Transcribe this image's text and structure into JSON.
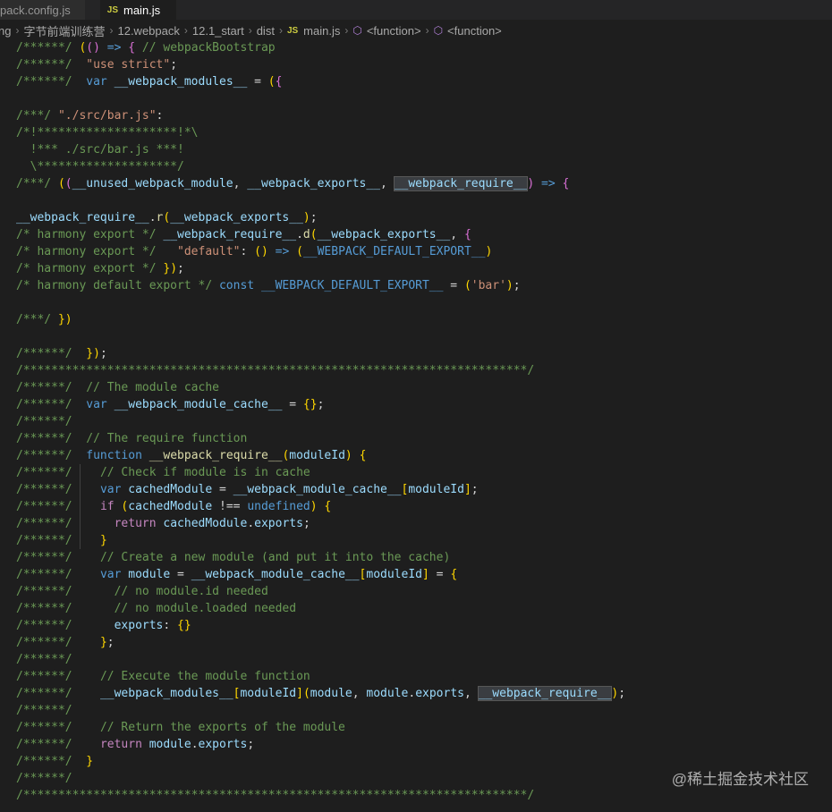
{
  "tabs": [
    {
      "label": "pack.config.js",
      "active": false
    },
    {
      "label": "main.js",
      "active": true,
      "badge": "JS"
    }
  ],
  "breadcrumb": {
    "items": [
      "ng",
      "字节前端训练营",
      "12.webpack",
      "12.1_start",
      "dist"
    ],
    "file": "main.js",
    "file_badge": "JS",
    "symbols": [
      "<function>",
      "<function>"
    ]
  },
  "code_lines": [
    "/******/ (() => { // webpackBootstrap",
    "/******/  \"use strict\";",
    "/******/  var __webpack_modules__ = ({",
    "",
    "/***/ \"./src/bar.js\":",
    "/*!********************!*\\",
    "  !*** ./src/bar.js ***!",
    "  \\********************/",
    "/***/ ((__unused_webpack_module, __webpack_exports__, __webpack_require__) => {",
    "",
    "__webpack_require__.r(__webpack_exports__);",
    "/* harmony export */ __webpack_require__.d(__webpack_exports__, {",
    "/* harmony export */   \"default\": () => (__WEBPACK_DEFAULT_EXPORT__)",
    "/* harmony export */ });",
    "/* harmony default export */ const __WEBPACK_DEFAULT_EXPORT__ = ('bar');",
    "",
    "/***/ })",
    "",
    "/******/  });",
    "/************************************************************************/",
    "/******/  // The module cache",
    "/******/  var __webpack_module_cache__ = {};",
    "/******/",
    "/******/  // The require function",
    "/******/  function __webpack_require__(moduleId) {",
    "/******/    // Check if module is in cache",
    "/******/    var cachedModule = __webpack_module_cache__[moduleId];",
    "/******/    if (cachedModule !== undefined) {",
    "/******/      return cachedModule.exports;",
    "/******/    }",
    "/******/    // Create a new module (and put it into the cache)",
    "/******/    var module = __webpack_module_cache__[moduleId] = {",
    "/******/      // no module.id needed",
    "/******/      // no module.loaded needed",
    "/******/      exports: {}",
    "/******/    };",
    "/******/",
    "/******/    // Execute the module function",
    "/******/    __webpack_modules__[moduleId](module, module.exports, __webpack_require__);",
    "/******/",
    "/******/    // Return the exports of the module",
    "/******/    return module.exports;",
    "/******/  }",
    "/******/",
    "/************************************************************************/"
  ],
  "watermark": "@稀土掘金技术社区",
  "colors": {
    "editor_bg": "#1e1e1e",
    "comment": "#6a9955",
    "keyword": "#569cd6",
    "control_keyword": "#c586c0",
    "variable": "#9cdcfe",
    "string": "#ce9178",
    "function": "#dcdcaa"
  }
}
